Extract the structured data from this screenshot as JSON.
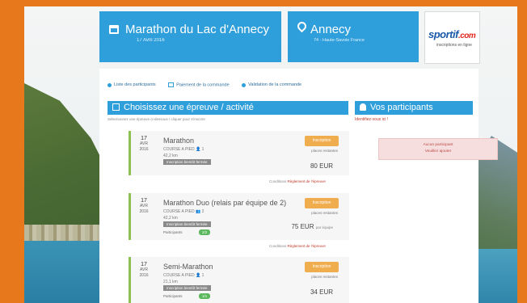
{
  "header": {
    "event_title": "Marathon du Lac d'Annecy",
    "event_sub": "17 Avril 2016",
    "location_title": "Annecy",
    "location_sub": "74 - Haute-Savoie France",
    "logo_text": "sportif",
    "logo_suffix": ".com",
    "logo_sub": "inscriptions en ligne"
  },
  "steps": [
    {
      "label": "Liste des participants",
      "icon": "circle-icon"
    },
    {
      "label": "Paiement de la commande",
      "icon": "card-icon"
    },
    {
      "label": "Validation de la commande",
      "icon": "check-circle-icon"
    }
  ],
  "section": {
    "title": "Choisissez une épreuve / activité",
    "subtitle": "Sélectionnez une épreuve ci-dessous / cliquer pour s'inscrire"
  },
  "participants": {
    "title": "Vos participants",
    "link": "Identifiez-vous ici !",
    "alert_line1": "Aucun participant",
    "alert_line2": "Veuillez ajouter"
  },
  "races": [
    {
      "date_day": "17",
      "date_month": "AVR",
      "date_year": "2016",
      "name": "Marathon",
      "meta": "COURSE A PIED 👤 1",
      "meta2": "42,2 km",
      "tag": "Inscription bientôt fermée",
      "tag2": "",
      "badge": "",
      "button": "Inscription",
      "places": "places restantes",
      "price": "80 EUR",
      "price_note": "",
      "conditions": "Conditions",
      "conditions_link": "Règlement de l'épreuve"
    },
    {
      "date_day": "17",
      "date_month": "AVR",
      "date_year": "2016",
      "name": "Marathon Duo (relais par équipe de 2)",
      "meta": "COURSE A PIED 👥 2",
      "meta2": "42,2 km",
      "tag": "Inscription bientôt fermée",
      "tag2": "Participants",
      "badge": "2/2",
      "button": "Inscription",
      "places": "places restantes",
      "price": "75 EUR",
      "price_note": "par équipe",
      "conditions": "Conditions",
      "conditions_link": "Règlement de l'épreuve"
    },
    {
      "date_day": "17",
      "date_month": "AVR",
      "date_year": "2016",
      "name": "Semi-Marathon",
      "meta": "COURSE A PIED 👤 1",
      "meta2": "21,1 km",
      "tag": "Inscription bientôt fermée",
      "tag2": "Participants",
      "badge": "1/1",
      "button": "Inscription",
      "places": "places restantes",
      "price": "34 EUR",
      "price_note": "",
      "conditions": "",
      "conditions_link": ""
    }
  ],
  "colors": {
    "frame": "#e8781c",
    "primary": "#2f9fdc",
    "button": "#f0ad4e",
    "race_border": "#8cc152",
    "alert_bg": "#f7dede"
  }
}
